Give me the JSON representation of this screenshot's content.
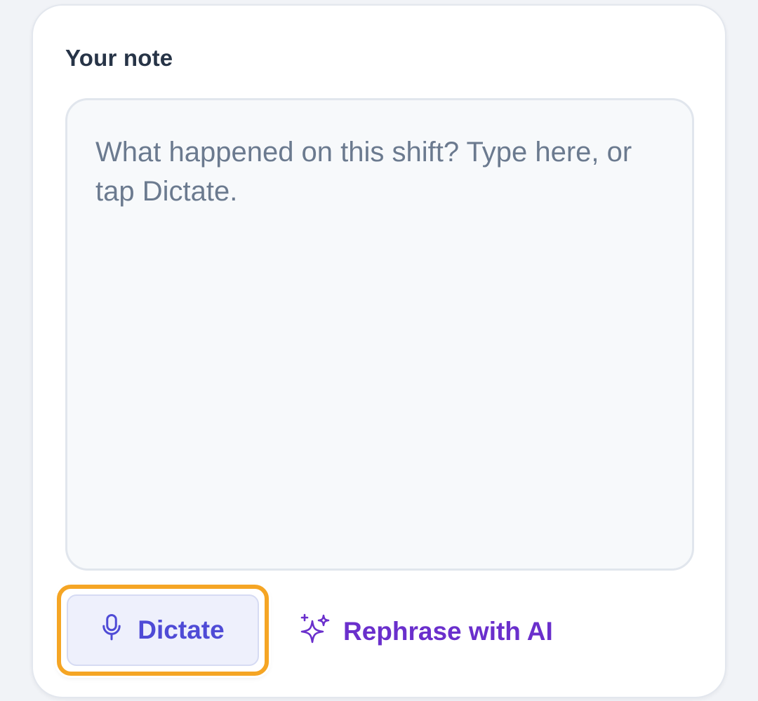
{
  "note": {
    "label": "Your note",
    "value": "",
    "placeholder": "What happened on this shift? Type here, or tap Dictate."
  },
  "actions": {
    "dictate": {
      "label": "Dictate",
      "icon": "microphone-icon",
      "focused": true
    },
    "rephrase": {
      "label": "Rephrase with AI",
      "icon": "sparkles-icon"
    }
  },
  "colors": {
    "accent_dictate": "#4f4bd6",
    "accent_ai": "#6a2fcc",
    "focus_ring": "#f5a524"
  }
}
